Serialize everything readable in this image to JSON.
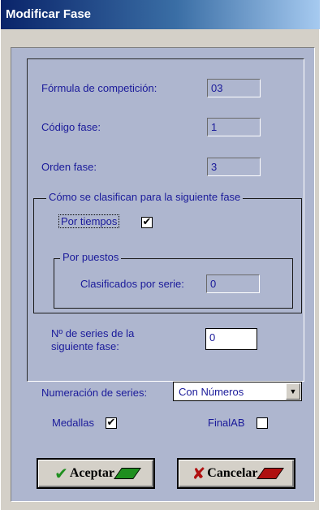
{
  "window": {
    "title": "Modificar Fase"
  },
  "form": {
    "formula": {
      "label": "Fórmula de competición:",
      "value": "03"
    },
    "codigo": {
      "label": "Código fase:",
      "value": "1"
    },
    "orden": {
      "label": "Orden fase:",
      "value": "3"
    }
  },
  "clasificacion": {
    "legend": "Cómo se clasifican para la siguiente fase",
    "por_tiempos": {
      "label": "Por tiempos",
      "checked": true,
      "mark": "✔"
    },
    "por_puestos": {
      "legend": "Por puestos",
      "clasificados": {
        "label": "Clasificados por serie:",
        "value": "0"
      }
    },
    "num_series": {
      "label_line1": "Nº de series de la",
      "label_line2": "siguiente fase:",
      "value": "0"
    }
  },
  "numeracion": {
    "label": "Numeración de series:",
    "value": "Con Números",
    "arrow": "▼"
  },
  "medallas": {
    "label": "Medallas",
    "checked": true,
    "mark": "✔"
  },
  "finalab": {
    "label": "FinalAB",
    "checked": false,
    "mark": ""
  },
  "buttons": {
    "aceptar": {
      "icon": "✔",
      "label": "Aceptar",
      "icon_color": "#1f8f1f",
      "stripe_color": "#1f8f1f"
    },
    "cancelar": {
      "icon": "✘",
      "label": "Cancelar",
      "icon_color": "#b01010",
      "stripe_color": "#b01010"
    }
  }
}
